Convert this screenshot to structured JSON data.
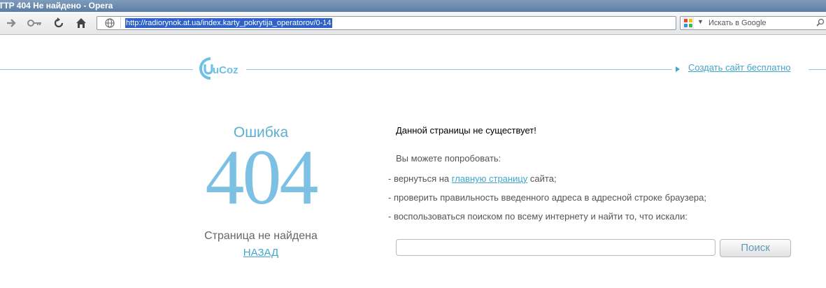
{
  "window": {
    "title": "TTP 404 Не найдено - Opera"
  },
  "toolbar": {
    "url": "http://radiorynok.at.ua/index.karty_pokrytija_operatorov/0-14",
    "search_placeholder": "Искать в Google",
    "icons": [
      "forward-arrow-icon",
      "key-icon",
      "reload-icon",
      "home-icon",
      "globe-icon",
      "google-icon",
      "magnifier-icon"
    ]
  },
  "header": {
    "logo_text": "uCoz",
    "create_link": "Создать сайт бесплатно"
  },
  "error": {
    "word": "Ошибка",
    "code": "404",
    "not_found": "Страница не найдена",
    "back": "НАЗАД"
  },
  "content": {
    "title": "Данной страницы не существует!",
    "try": "Вы можете попробовать:",
    "line1_prefix": "- вернуться на",
    "line1_link": "главную страницу",
    "line1_suffix": "сайта;",
    "line2": "- проверить правильность введенного адреса в адресной строке браузера;",
    "line3": "- воспользоваться поиском по всему интернету и найти то, что искали:",
    "search_button": "Поиск"
  },
  "colors": {
    "accent": "#42a5cc",
    "code": "#7cc1e4",
    "rule": "#8fcbe0"
  }
}
